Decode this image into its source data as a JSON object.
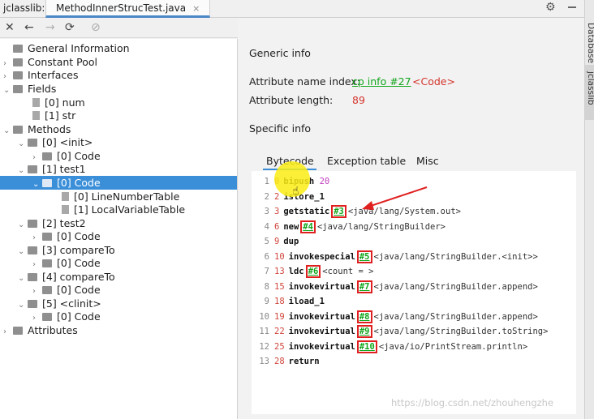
{
  "titlebar": {
    "app": "jclasslib:",
    "tab": "MethodInnerStrucTest.java",
    "close": "×"
  },
  "toolbar": {
    "close": "✕",
    "back": "←",
    "forward": "→",
    "refresh": "⟳",
    "browser": "⊘"
  },
  "tree": {
    "general": "General Information",
    "constant_pool": "Constant Pool",
    "interfaces": "Interfaces",
    "fields": "Fields",
    "field0": "[0] num",
    "field1": "[1] str",
    "methods": "Methods",
    "m0": "[0] <init>",
    "m0_code": "[0] Code",
    "m1": "[1] test1",
    "m1_code": "[0] Code",
    "m1_lnt": "[0] LineNumberTable",
    "m1_lvt": "[1] LocalVariableTable",
    "m2": "[2] test2",
    "m2_code": "[0] Code",
    "m3": "[3] compareTo",
    "m3_code": "[0] Code",
    "m4": "[4] compareTo",
    "m4_code": "[0] Code",
    "m5": "[5] <clinit>",
    "m5_code": "[0] Code",
    "attributes": "Attributes"
  },
  "detail": {
    "generic_info": "Generic info",
    "attr_name_label": "Attribute name index:",
    "attr_name_link": "cp info #27",
    "attr_name_value": "<Code>",
    "attr_len_label": "Attribute length:",
    "attr_len_value": "89",
    "specific_info": "Specific info",
    "tabs": {
      "bytecode": "Bytecode",
      "exception": "Exception table",
      "misc": "Misc"
    }
  },
  "bytecode": [
    {
      "line": "1",
      "pc": "0",
      "op": "bipush",
      "arg": "20"
    },
    {
      "line": "2",
      "pc": "2",
      "op": "istore_1"
    },
    {
      "line": "3",
      "pc": "3",
      "op": "getstatic",
      "ref": "#3",
      "comment": "<java/lang/System.out>"
    },
    {
      "line": "4",
      "pc": "6",
      "op": "new",
      "ref": "#4",
      "comment": "<java/lang/StringBuilder>"
    },
    {
      "line": "5",
      "pc": "9",
      "op": "dup"
    },
    {
      "line": "6",
      "pc": "10",
      "op": "invokespecial",
      "ref": "#5",
      "comment": "<java/lang/StringBuilder.<init>>"
    },
    {
      "line": "7",
      "pc": "13",
      "op": "ldc",
      "ref": "#6",
      "comment": "<count = >"
    },
    {
      "line": "8",
      "pc": "15",
      "op": "invokevirtual",
      "ref": "#7",
      "comment": "<java/lang/StringBuilder.append>"
    },
    {
      "line": "9",
      "pc": "18",
      "op": "iload_1"
    },
    {
      "line": "10",
      "pc": "19",
      "op": "invokevirtual",
      "ref": "#8",
      "comment": "<java/lang/StringBuilder.append>"
    },
    {
      "line": "11",
      "pc": "22",
      "op": "invokevirtual",
      "ref": "#9",
      "comment": "<java/lang/StringBuilder.toString>"
    },
    {
      "line": "12",
      "pc": "25",
      "op": "invokevirtual",
      "ref": "#10",
      "comment": "<java/io/PrintStream.println>"
    },
    {
      "line": "13",
      "pc": "28",
      "op": "return"
    }
  ],
  "watermark": "https://blog.csdn.net/zhouhengzhe",
  "side_tabs": {
    "database": "Database",
    "jclasslib": "jclasslib"
  },
  "colors": {
    "accent": "#3b8fd9",
    "link": "#12a61c",
    "value_red": "#d3342c",
    "annotation": "#e02020"
  }
}
